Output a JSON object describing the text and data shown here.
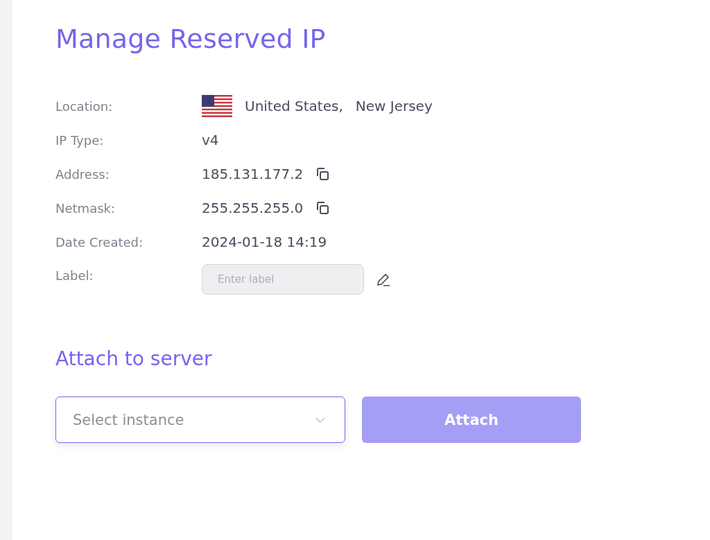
{
  "title": "Manage Reserved IP",
  "details": [
    {
      "kind": "location",
      "label": "Location:",
      "country": "United States,",
      "region": "New Jersey"
    },
    {
      "kind": "text",
      "label": "IP Type:",
      "value": "v4"
    },
    {
      "kind": "copyable",
      "label": "Address:",
      "value": "185.131.177.2"
    },
    {
      "kind": "copyable",
      "label": "Netmask:",
      "value": "255.255.255.0"
    },
    {
      "kind": "text",
      "label": "Date Created:",
      "value": "2024-01-18 14:19"
    },
    {
      "kind": "input",
      "label": "Label:",
      "placeholder": "Enter label"
    }
  ],
  "attach": {
    "heading": "Attach to server",
    "select": {
      "placeholder": "Select instance"
    },
    "button": {
      "label": "Attach",
      "disabled": true
    }
  }
}
